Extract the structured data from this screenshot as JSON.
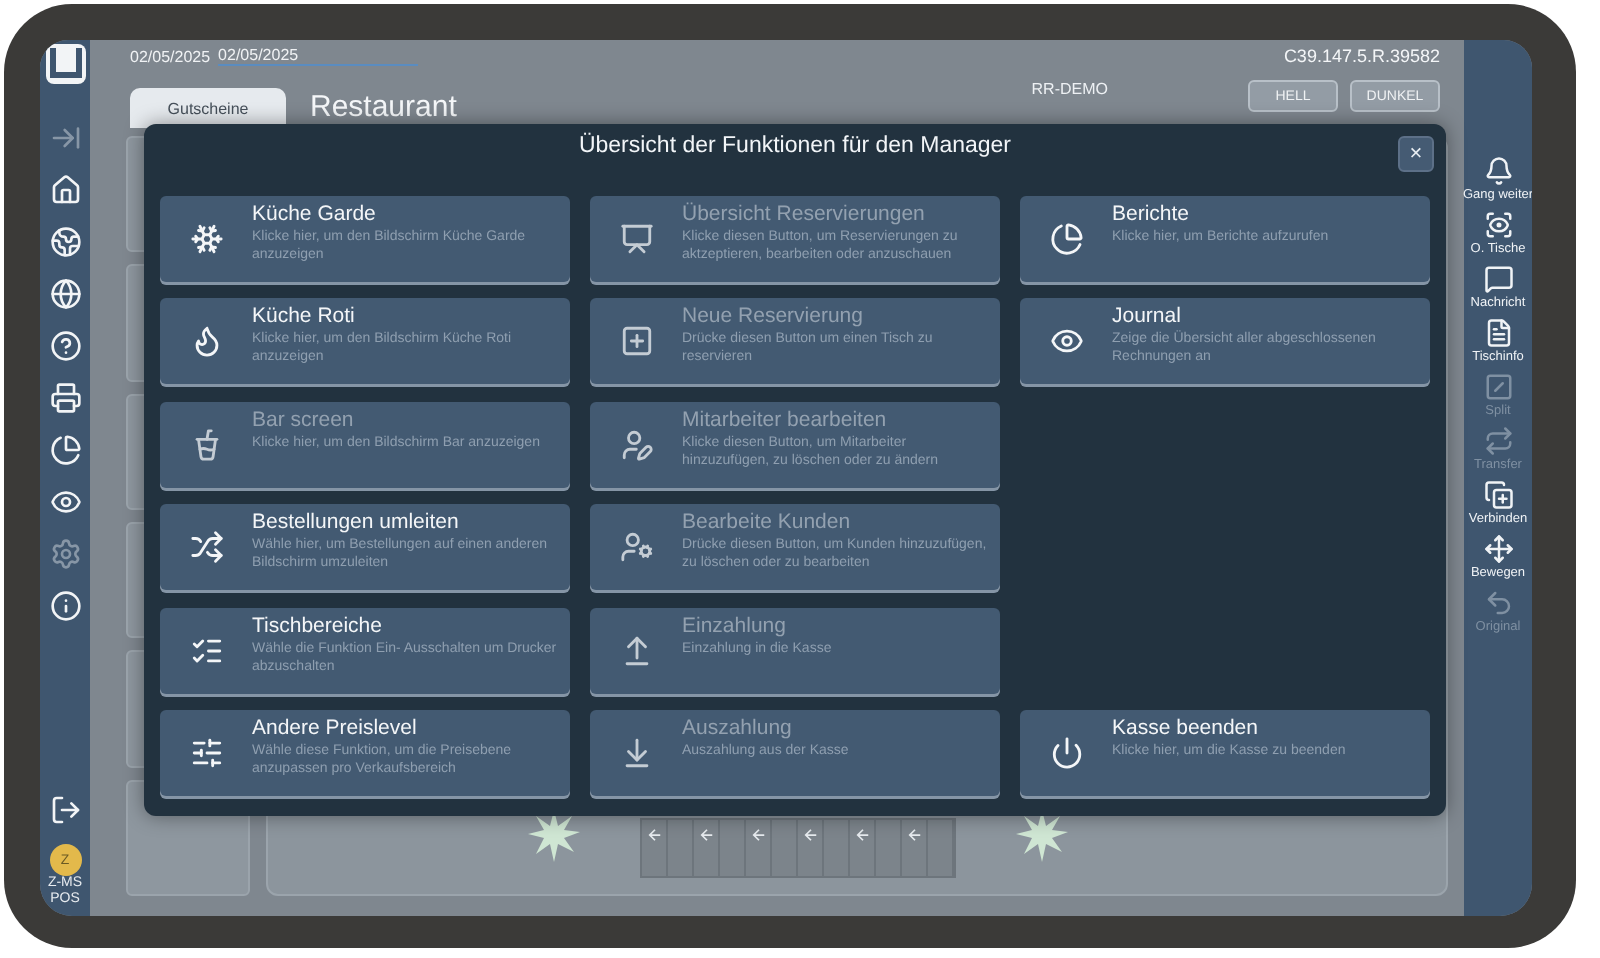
{
  "header": {
    "date_from": "02/05/2025",
    "date_to": "02/05/2025",
    "tab": {
      "label": "Gutscheine",
      "selected": true
    },
    "title": "Restaurant",
    "site": "RR-DEMO",
    "theme_buttons": [
      {
        "label": "HELL",
        "selected": false
      },
      {
        "label": "DUNKEL",
        "selected": false
      }
    ],
    "version": "C39.147.5.R.39582"
  },
  "left_sidebar": {
    "items": [
      {
        "disabled": true
      },
      {
        "disabled": false
      },
      {
        "disabled": false
      },
      {
        "disabled": false
      },
      {
        "disabled": false
      },
      {
        "disabled": false
      },
      {
        "disabled": false
      },
      {
        "disabled": false
      },
      {
        "disabled": true
      },
      {
        "disabled": false
      }
    ],
    "user": {
      "initial": "Z",
      "name": "Z-MS POS"
    }
  },
  "right_sidebar": {
    "items": [
      {
        "label": "Gang weiter",
        "disabled": false
      },
      {
        "label": "O. Tische",
        "disabled": false
      },
      {
        "label": "Nachricht",
        "disabled": false
      },
      {
        "label": "Tischinfo",
        "disabled": false
      },
      {
        "label": "Split",
        "disabled": true
      },
      {
        "label": "Transfer",
        "disabled": true
      },
      {
        "label": "Verbinden",
        "disabled": false
      },
      {
        "label": "Bewegen",
        "disabled": false
      },
      {
        "label": "Original",
        "disabled": true
      }
    ]
  },
  "dialog": {
    "title": "Übersicht der Funktionen für den Manager",
    "close": "×",
    "columns": [
      {
        "items": [
          {
            "kind": "function",
            "title": "Küche Garde",
            "description": "Klicke hier, um den Bildschirm Küche Garde anzuzeigen",
            "disabled": false
          },
          {
            "kind": "function",
            "title": "Küche Roti",
            "description": "Klicke hier, um den Bildschirm Küche Roti anzuzeigen",
            "disabled": false
          },
          {
            "kind": "function",
            "title": "Bar screen",
            "description": "Klicke hier, um den Bildschirm Bar anzuzeigen",
            "disabled": true
          },
          {
            "kind": "function",
            "title": "Bestellungen umleiten",
            "description": "Wähle hier, um Bestellungen auf einen anderen Bildschirm umzuleiten",
            "disabled": false
          },
          {
            "kind": "function",
            "title": "Tischbereiche",
            "description": "Wähle die Funktion Ein- Ausschalten um Drucker abzuschalten",
            "disabled": false
          },
          {
            "kind": "function",
            "title": "Andere Preislevel",
            "description": "Wähle diese Funktion, um die Preisebene anzupassen pro Verkaufsbereich",
            "disabled": false
          }
        ]
      },
      {
        "items": [
          {
            "kind": "function",
            "title": "Übersicht Reservierungen",
            "description": "Klicke diesen Button, um Reservierungen zu aktzeptieren, bearbeiten oder anzuschauen",
            "disabled": true
          },
          {
            "kind": "function",
            "title": "Neue Reservierung",
            "description": "Drücke diesen Button um einen Tisch zu reservieren",
            "disabled": true
          },
          {
            "kind": "function",
            "title": "Mitarbeiter bearbeiten",
            "description": "Klicke diesen Button, um Mitarbeiter hinzuzufügen, zu löschen oder zu ändern",
            "disabled": true
          },
          {
            "kind": "function",
            "title": "Bearbeite Kunden",
            "description": "Drücke diesen Button, um Kunden hinzuzufügen, zu löschen oder zu bearbeiten",
            "disabled": true
          },
          {
            "kind": "function",
            "title": "Einzahlung",
            "description": "Einzahlung in die Kasse",
            "disabled": true
          },
          {
            "kind": "function",
            "title": "Auszahlung",
            "description": "Auszahlung aus der Kasse",
            "disabled": true
          }
        ]
      },
      {
        "items": [
          {
            "kind": "function",
            "title": "Berichte",
            "description": "Klicke hier, um Berichte aufzurufen",
            "disabled": false
          },
          {
            "kind": "function",
            "title": "Journal",
            "description": "Zeige die Übersicht aller abgeschlossenen Rechnungen an",
            "disabled": false
          },
          {
            "kind": "exit",
            "title": "Kasse beenden",
            "description": "Klicke hier, um die Kasse zu beenden",
            "disabled": false
          }
        ]
      }
    ]
  }
}
